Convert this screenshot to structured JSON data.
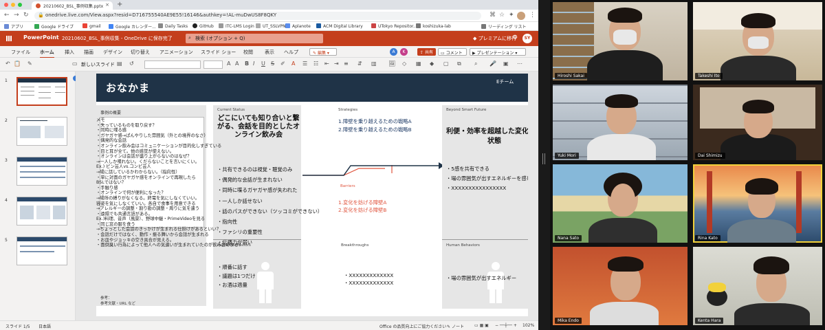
{
  "browser": {
    "tab_title": "20210602_BSL_事例収集.pptx",
    "url": "onedrive.live.com/View.aspx?resid=D716755540AE9E55!16146&authkey=!AL-muDwUS8F8QKY",
    "bookmarks": [
      "アプリ",
      "Google ドライブ",
      "gmail",
      "Google カレンダー...",
      "Daily Tasks",
      "GitHub",
      "ITC-LMS Login",
      "UT_SSLVPN",
      "Aplanote",
      "ACM Digital Library",
      "UTokyo Repositor...",
      "koshizuka-lab",
      "リーディング リスト"
    ]
  },
  "ppt": {
    "app_name": "PowerPoint",
    "file_name": "20210602_BSL_事例収集 - OneDrive に保存完了",
    "search_placeholder": "検索 (オプション + Q)",
    "premium": "プレミアムに移行",
    "user_initials": "SY",
    "menu": [
      "ファイル",
      "ホーム",
      "挿入",
      "描画",
      "デザイン",
      "切り替え",
      "アニメーション",
      "スライド ショー",
      "校閲",
      "表示",
      "ヘルプ"
    ],
    "edit_label": "編集",
    "share_label": "共有",
    "comment_label": "コメント",
    "present_label": "プレゼンテーション",
    "new_slide": "新しいスライド",
    "coauthor_1_initial": "A",
    "coauthor_2_initial": "K"
  },
  "thumbs": [
    "1",
    "2",
    "3",
    "4",
    "5"
  ],
  "slide": {
    "title": "おなかま",
    "team": "Eチーム",
    "case_title": "事例の概要",
    "memo": [
      "メモ",
      "・失っているものを取り戻す？",
      "・同時に喋る感",
      "・ガヤガヤ感→ぱんやりした雰囲気（外との境界のなさ）",
      "・偶発的な会話",
      "・オンライン飲み会はコミュニケーションが目的化しすぎている",
      "・目と耳が全て。他の感覚が使えない。",
      "・オンラインは会話が盛り上がらないのはなぜ？",
      "→一人しか喋れない。くだらないことを言いにくい。",
      "Ex.) ピン芸人vs.コンビ芸人",
      "→場に話しているかわからない。（指向性）",
      "・単に対面のガヤガヤ感をオンラインで再現したら",
      "BSLではない？",
      "・手触り感",
      "・オンラインで何が便利になった？",
      "→場所の縛りがなくなる。終電を気にしなくていい。",
      "容姿を気にしなくていい。各自で食事を用意できる",
      "→アレルギーの調整・割り勘の調整・周りに気を遣う",
      "・遠隔でも共通言語がある。",
      "Ex.)料理、音声（風景）、野球中継・PrimeVideoを見る",
      "・同じ窓の服を食う",
      "→ちょっとした会話のきっかけが生まれる仕掛けがあるといい？",
      "・会話だけではなく、動作・振る舞いから会話が生まれる",
      "・お皿やジョッキの空き具合が見える。",
      "・面倒臭い行為によって他人への気遣いが生まれていたのが飲み会のよさ？"
    ],
    "ref_label": "参考：",
    "ref_value": "参考文献・URL など",
    "current_label": "Current Status",
    "current_title": "どこにいても知り合いと繋がる、会話を目的としたオンライン飲み会",
    "current_items": [
      "・共有できるのは視覚・聴覚のみ",
      "・偶発的な会話が生まれない",
      "・同時に喋るガヤガヤ感が失われた",
      "・一人しか話せない",
      "・話のパスができない（ツッコミができない）",
      "・指向性",
      "・ファシリの重要性",
      "・伝播力が弱い"
    ],
    "hb_label": "Human Behaviors",
    "hb_items": [
      "・順番に話す",
      "・議題は1つだけ",
      "・お酒は適量"
    ],
    "strategies_label": "Strategies",
    "strategies": [
      "1.障壁を乗り越えるための戦略A",
      "2.障壁を乗り越えるための戦略B"
    ],
    "barriers_label": "Barriers",
    "barriers": [
      "1.変化を妨げる障壁A",
      "2.変化を妨げる障壁B"
    ],
    "breakthroughs_label": "Breakthroughs",
    "breakthroughs": [
      "・XXXXXXXXXXXXX",
      "・XXXXXXXXXXXXX"
    ],
    "beyond_label": "Beyond Smart Future",
    "beyond_title": "利便・効率を超越した変化後の状態",
    "beyond_items": [
      "・5感を共有できる",
      "・場の雰囲気が出すエネルギーを感じられる",
      "・XXXXXXXXXXXXXXXX"
    ],
    "beyond_hb_label": "Human Behaviors",
    "beyond_hb": "・場の雰囲気が出すエネルギー"
  },
  "status": {
    "slide_num": "スライド 1/5",
    "lang": "日本語",
    "feedback": "Office の品質向上にご協力ください",
    "notes": "ノート",
    "zoom": "102%"
  },
  "zoom_tiles": [
    {
      "name": "Hiroshi Sakai"
    },
    {
      "name": "Takeshi Ito"
    },
    {
      "name": "Yuki Mori"
    },
    {
      "name": "Dai Shimizu"
    },
    {
      "name": "Nana Sato"
    },
    {
      "name": "Rina Kato"
    },
    {
      "name": "Mika Endo"
    },
    {
      "name": "Kenta Hara"
    }
  ],
  "colors": {
    "ppt_accent": "#c43e1c",
    "slide_header": "#1f3347",
    "strategy_blue": "#1f3b66",
    "barrier_red": "#e0533c",
    "speaking": "#f2d13a"
  }
}
